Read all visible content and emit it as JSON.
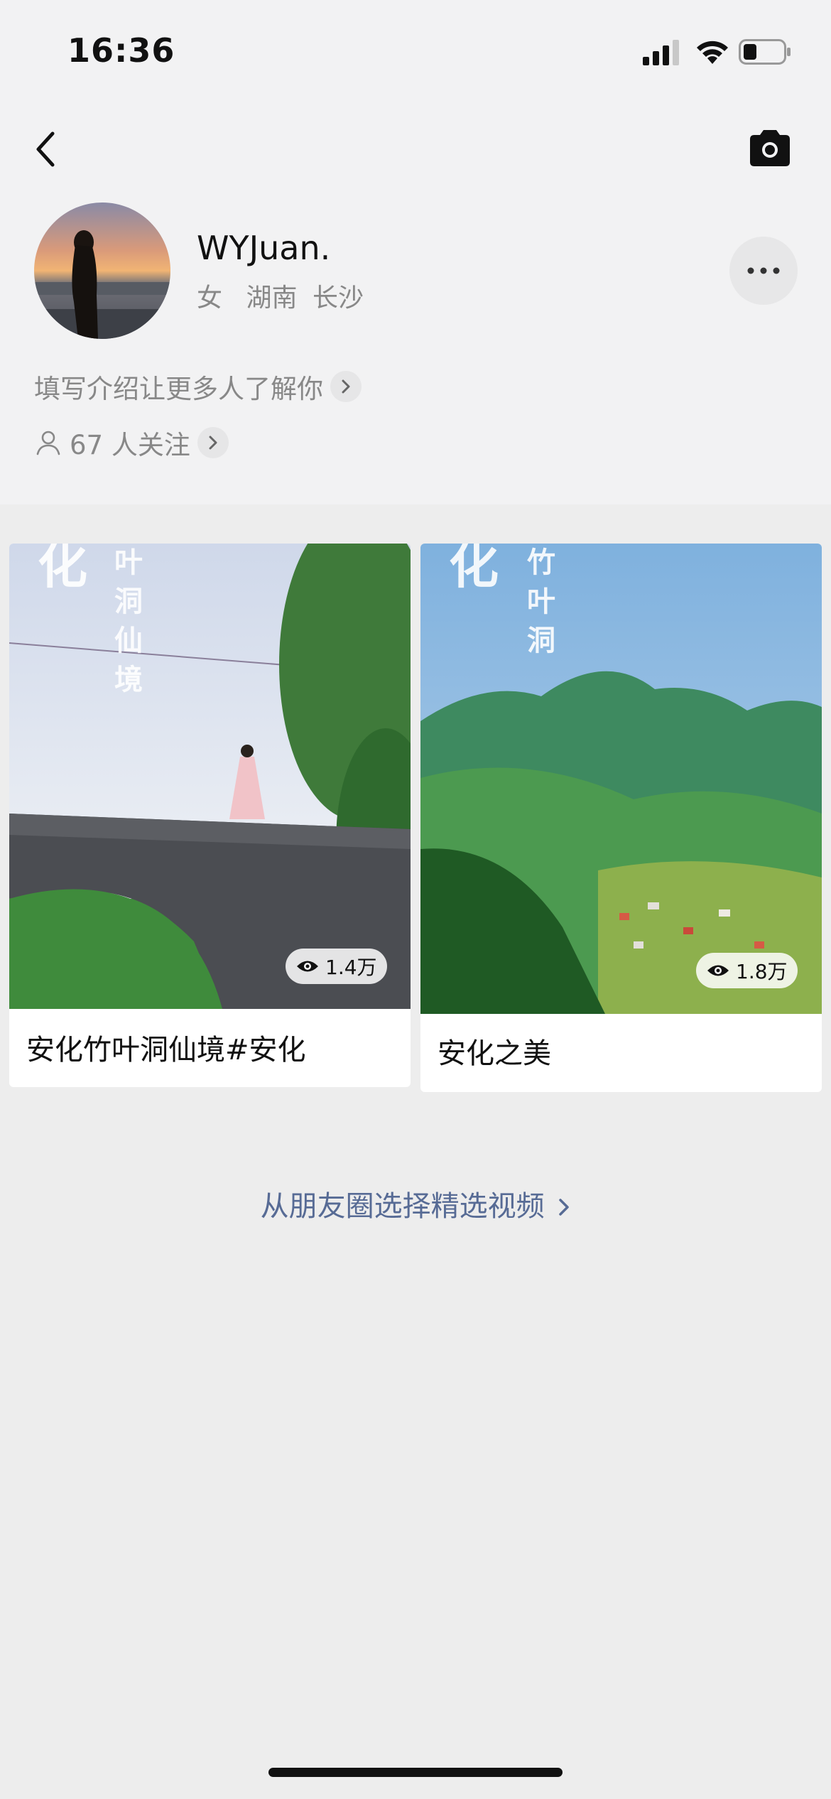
{
  "status_bar": {
    "time": "16:36"
  },
  "profile": {
    "username": "WYJuan.",
    "gender": "女",
    "province": "湖南",
    "city": "长沙",
    "intro_prompt": "填写介绍让更多人了解你",
    "followers_text": "67 人关注"
  },
  "videos": [
    {
      "title": "安化竹叶洞仙境#安化",
      "views": "1.4万",
      "overlay_text": "化 叶洞仙境"
    },
    {
      "title": "安化之美",
      "views": "1.8万",
      "overlay_text": "化 竹叶洞"
    }
  ],
  "select_link": "从朋友圈选择精选视频",
  "icons": {
    "back": "chevron-left-icon",
    "camera": "camera-icon",
    "more": "ellipsis-icon",
    "follow": "person-icon",
    "views": "eye-icon"
  },
  "colors": {
    "link": "#576b95",
    "page_bg": "#ededed"
  }
}
